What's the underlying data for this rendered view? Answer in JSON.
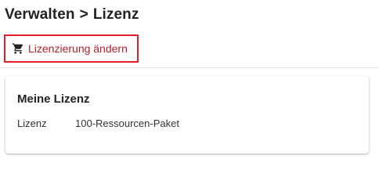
{
  "breadcrumb": {
    "parent": "Verwalten",
    "separator": ">",
    "current": "Lizenz"
  },
  "toolbar": {
    "change_license_label": "Lizenzierung ändern",
    "change_license_icon": "shopping-cart-icon",
    "accent_color": "#e3202a"
  },
  "license_card": {
    "title": "Meine Lizenz",
    "field_label": "Lizenz",
    "field_value": "100-Ressourcen-Paket"
  }
}
